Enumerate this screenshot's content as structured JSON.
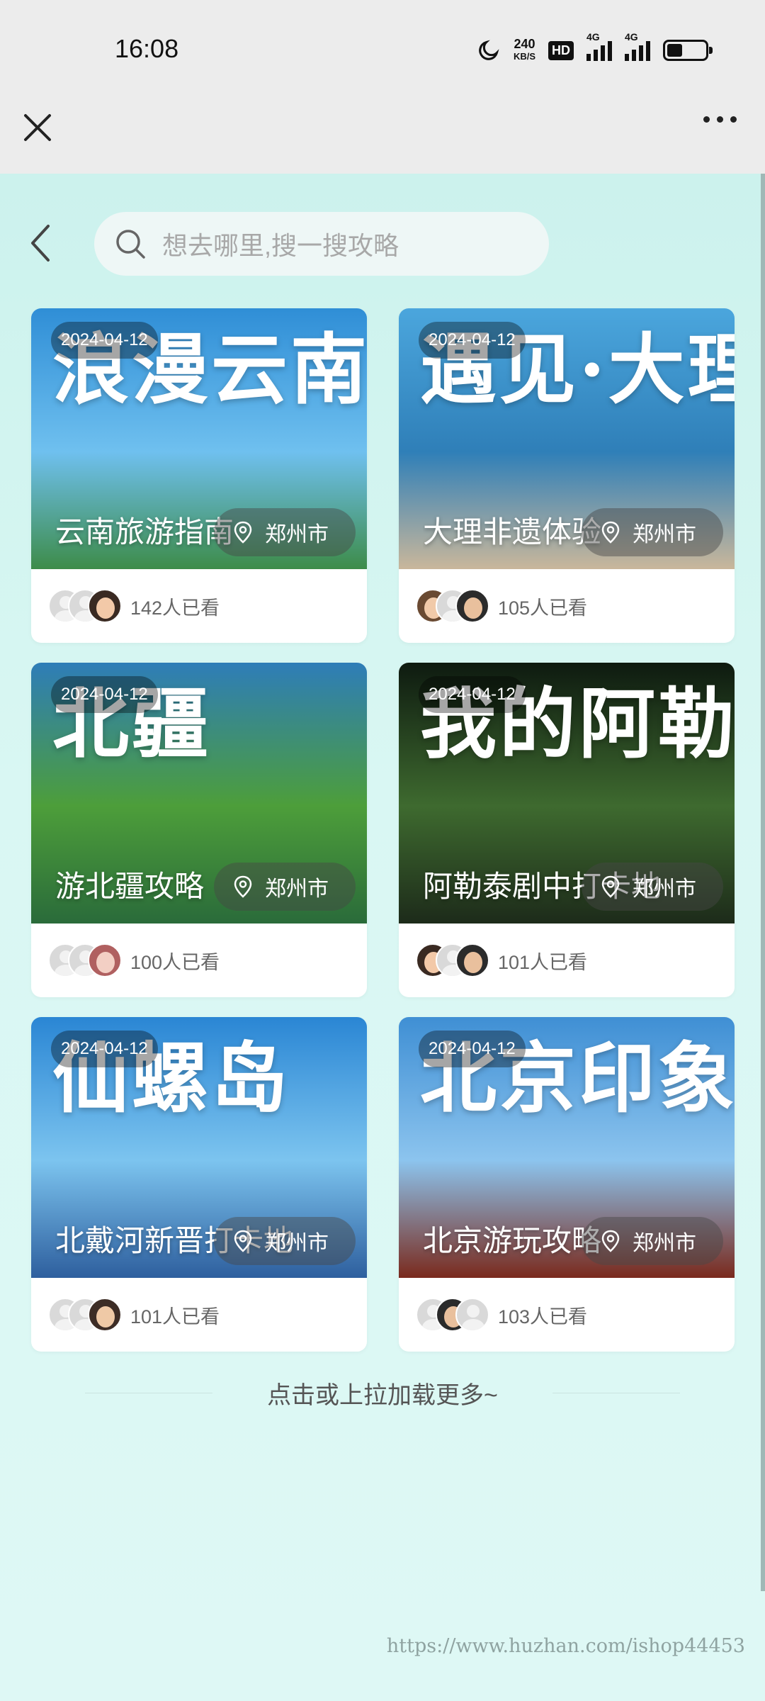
{
  "status_bar": {
    "time": "16:08",
    "net_speed_value": "240",
    "net_speed_unit": "KB/S",
    "hd_label": "HD",
    "signal1_label": "4G",
    "signal2_label": "4G",
    "battery_level": 0.4
  },
  "search": {
    "placeholder": "想去哪里,搜一搜攻略"
  },
  "cards": [
    {
      "big_title": "浪漫云南",
      "date": "2024-04-12",
      "title": "云南旅游指南",
      "location": "郑州市",
      "views": "142人已看",
      "colors": [
        "#2f8ed6",
        "#6fc0ef",
        "#3d8c4a"
      ]
    },
    {
      "big_title": "遇见·大理",
      "date": "2024-04-12",
      "title": "大理非遗体验",
      "location": "郑州市",
      "views": "105人已看",
      "colors": [
        "#4ba6dd",
        "#2f7fb8",
        "#c9b79b"
      ]
    },
    {
      "big_title": "北疆",
      "date": "2024-04-12",
      "title": "游北疆攻略",
      "location": "郑州市",
      "views": "100人已看",
      "colors": [
        "#2e7db8",
        "#4d9e3a",
        "#2a6b3a"
      ]
    },
    {
      "big_title": "我的阿勒泰",
      "date": "2024-04-12",
      "title": "阿勒泰剧中打卡地",
      "location": "郑州市",
      "views": "101人已看",
      "colors": [
        "#0e1a10",
        "#3e6a2f",
        "#1d2b1a"
      ]
    },
    {
      "big_title": "仙螺岛",
      "date": "2024-04-12",
      "title": "北戴河新晋打卡地",
      "location": "郑州市",
      "views": "101人已看",
      "colors": [
        "#2a86d4",
        "#7cc4ef",
        "#2e5f9e"
      ]
    },
    {
      "big_title": "北京印象",
      "date": "2024-04-12",
      "title": "北京游玩攻略",
      "location": "郑州市",
      "views": "103人已看",
      "colors": [
        "#3f8fd4",
        "#8cc4ee",
        "#7a2a1d"
      ]
    }
  ],
  "load_more": "点击或上拉加载更多~",
  "watermark": "https://www.huzhan.com/ishop44453"
}
